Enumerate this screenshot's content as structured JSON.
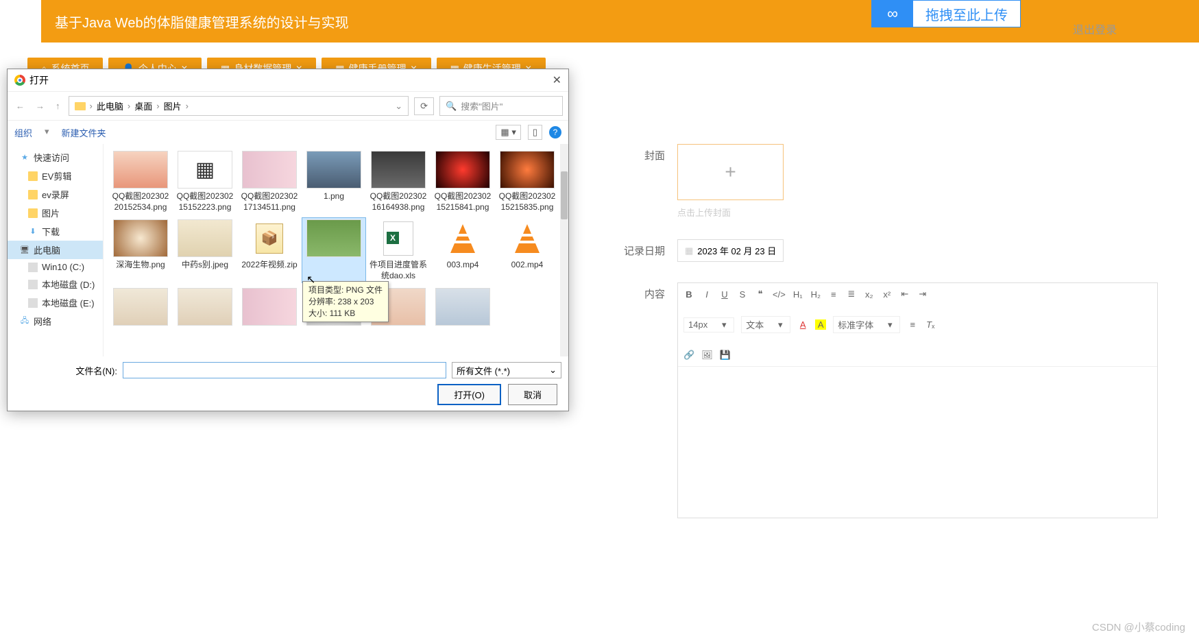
{
  "header": {
    "title": "基于Java Web的体脂健康管理系统的设计与实现"
  },
  "upload": {
    "text": "拖拽至此上传"
  },
  "logout": "退出登录",
  "tabs": [
    {
      "label": "系统首页",
      "icon": "home"
    },
    {
      "label": "个人中心",
      "icon": "user",
      "closable": true
    },
    {
      "label": "身材数据管理",
      "icon": "grid",
      "closable": true
    },
    {
      "label": "健康手册管理",
      "icon": "grid",
      "closable": true
    },
    {
      "label": "健康生活管理",
      "icon": "grid",
      "closable": true
    }
  ],
  "form": {
    "cover_label": "封面",
    "cover_hint": "点击上传封面",
    "date_label": "记录日期",
    "date_value": "2023 年 02 月 23 日",
    "content_label": "内容",
    "editor": {
      "font_size": "14px",
      "font_family_label": "文本",
      "heading_label": "标准字体"
    }
  },
  "dialog": {
    "title": "打开",
    "breadcrumb": [
      "此电脑",
      "桌面",
      "图片"
    ],
    "search_placeholder": "搜索\"图片\"",
    "organize": "组织",
    "new_folder": "新建文件夹",
    "sidebar": [
      {
        "label": "快速访问",
        "icon": "star"
      },
      {
        "label": "EV剪辑",
        "icon": "folder",
        "indent": true
      },
      {
        "label": "ev录屏",
        "icon": "folder",
        "indent": true
      },
      {
        "label": "图片",
        "icon": "folder",
        "indent": true
      },
      {
        "label": "下载",
        "icon": "down",
        "indent": true
      },
      {
        "label": "此电脑",
        "icon": "pc",
        "selected": true
      },
      {
        "label": "Win10 (C:)",
        "icon": "drive",
        "indent": true
      },
      {
        "label": "本地磁盘 (D:)",
        "icon": "drive",
        "indent": true
      },
      {
        "label": "本地磁盘 (E:)",
        "icon": "drive",
        "indent": true
      },
      {
        "label": "网络",
        "icon": "net"
      }
    ],
    "files_row1": [
      {
        "name": "QQ截图20230220152534.png",
        "thumb": "photo1"
      },
      {
        "name": "QQ截图20230215152223.png",
        "thumb": "qr"
      },
      {
        "name": "QQ截图20230217134511.png",
        "thumb": "pink"
      },
      {
        "name": "1.png",
        "thumb": "city"
      },
      {
        "name": "QQ截图20230216164938.png",
        "thumb": "moto"
      },
      {
        "name": "QQ截图20230215215841.png",
        "thumb": "red"
      },
      {
        "name": "QQ截图20230215215835.png",
        "thumb": "orange"
      }
    ],
    "files_row2": [
      {
        "name": "深海生物.png",
        "thumb": "sea"
      },
      {
        "name": "中药s别.jpeg",
        "thumb": "herb"
      },
      {
        "name": "2022年视频.zip",
        "thumb": "zip"
      },
      {
        "name": "",
        "thumb": "flower",
        "selected": true
      },
      {
        "name": "件项目进度管系统dao.xls",
        "thumb": "xls"
      },
      {
        "name": "003.mp4",
        "thumb": "vlc"
      },
      {
        "name": "002.mp4",
        "thumb": "vlc"
      }
    ],
    "files_row3": [
      {
        "name": "",
        "thumb": "id"
      },
      {
        "name": "",
        "thumb": "id"
      },
      {
        "name": "",
        "thumb": "pink"
      },
      {
        "name": "",
        "thumb": "old"
      },
      {
        "name": "",
        "thumb": "girl"
      },
      {
        "name": "",
        "thumb": "boy"
      }
    ],
    "tooltip": {
      "line1": "项目类型: PNG 文件",
      "line2": "分辨率: 238 x 203",
      "line3": "大小: 111 KB"
    },
    "filename_label": "文件名(N):",
    "filename_value": "",
    "filter": "所有文件 (*.*)",
    "open_btn": "打开(O)",
    "cancel_btn": "取消"
  },
  "watermark": "CSDN @小蔡coding"
}
